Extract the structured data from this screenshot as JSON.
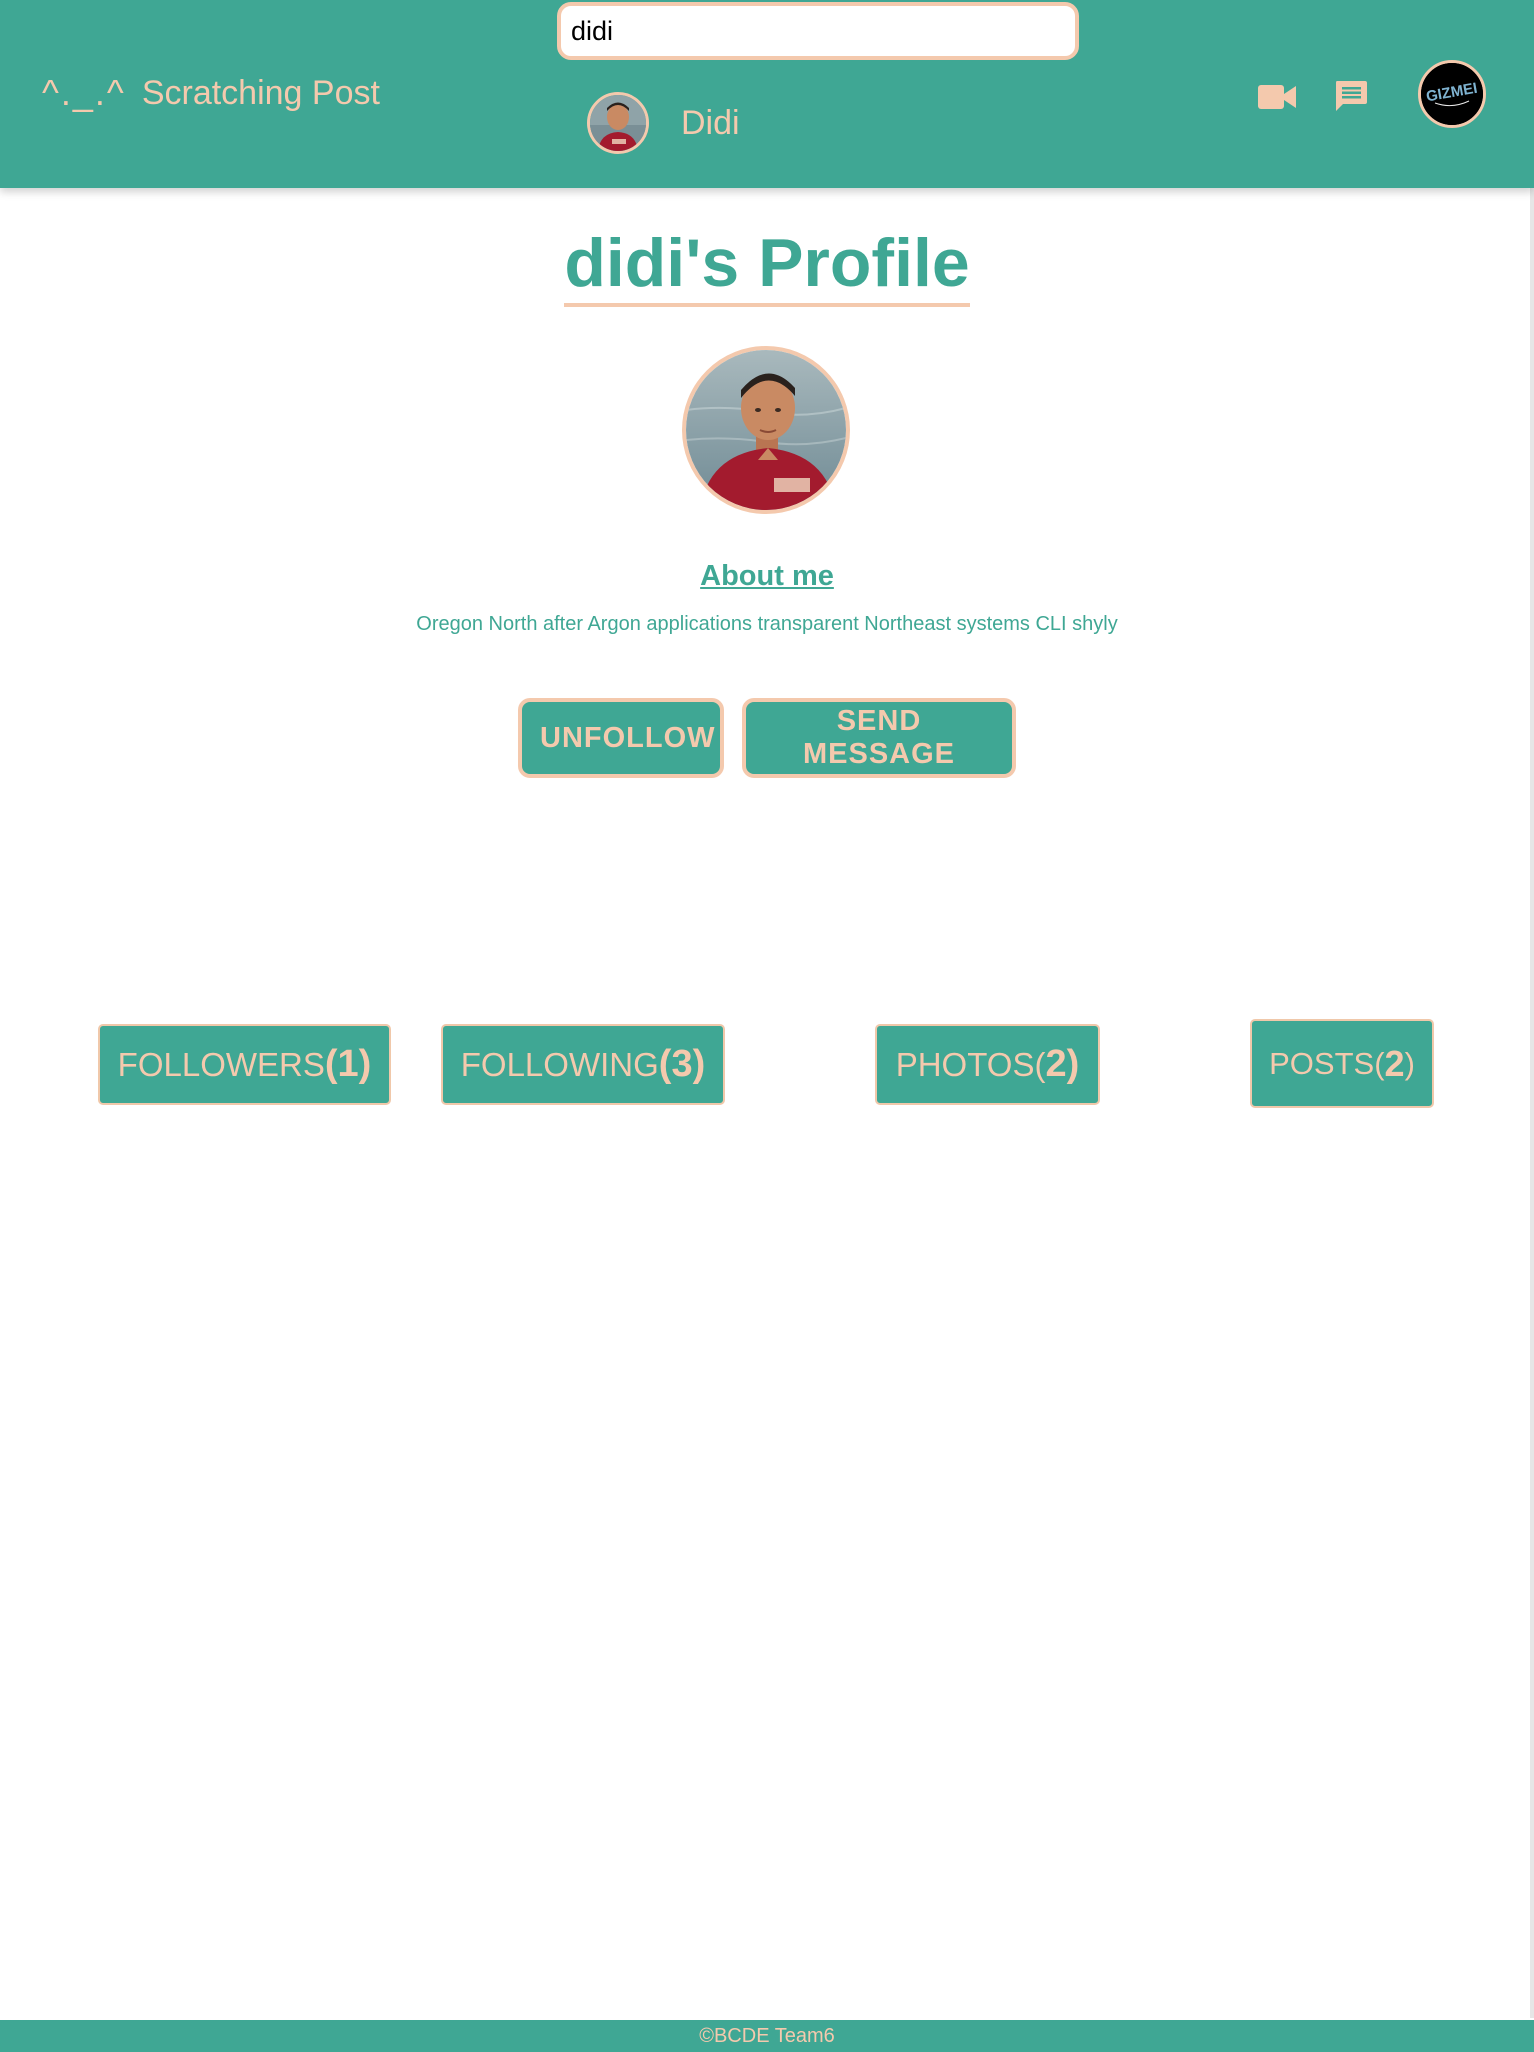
{
  "navbar": {
    "logo_text": "^._.^",
    "app_name": "Scratching Post",
    "search": {
      "value": "didi",
      "placeholder": "",
      "results": [
        {
          "name": "Didi"
        }
      ]
    },
    "icons": [
      "video-camera-icon",
      "chat-bubble-icon"
    ],
    "user_avatar_text": "GIZMEI"
  },
  "profile": {
    "title": "didi's Profile",
    "about_heading": "About me",
    "about_text": "Oregon North after Argon applications transparent Northeast systems CLI shyly",
    "actions": {
      "unfollow_label": "UNFOLLOW",
      "message_label": "SEND MESSAGE"
    }
  },
  "tabs": {
    "followers": {
      "label": "FOLLOWERS ",
      "open": "(",
      "count": "1",
      "close": ")"
    },
    "following": {
      "label": "FOLLOWING ",
      "open": "(",
      "count": "3",
      "close": ")"
    },
    "photos": {
      "label": "PHOTOS ",
      "open": "(",
      "count": "2",
      "close": ")"
    },
    "posts": {
      "label": "POSTS ",
      "open": "(",
      "count": "2",
      "close": ")"
    }
  },
  "footer": {
    "text": "©BCDE Team6"
  },
  "colors": {
    "primary": "#3fa794",
    "accent": "#f4c9ad",
    "background": "#ffffff"
  }
}
